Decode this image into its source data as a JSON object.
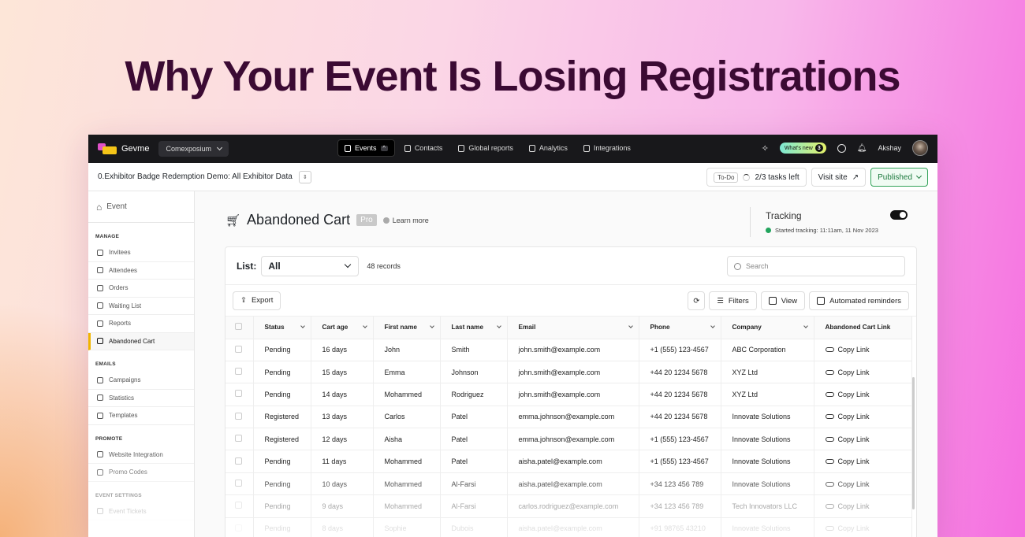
{
  "headline": "Why Your Event Is Losing Registrations",
  "topbar": {
    "brand": "Gevme",
    "org": "Comexposium",
    "nav": [
      {
        "label": "Events",
        "icon": "list-icon",
        "active": true,
        "chip": "^"
      },
      {
        "label": "Contacts",
        "icon": "contacts-icon"
      },
      {
        "label": "Global reports",
        "icon": "report-icon"
      },
      {
        "label": "Analytics",
        "icon": "pie-chart-icon"
      },
      {
        "label": "Integrations",
        "icon": "puzzle-icon"
      }
    ],
    "whats_new": "What's new",
    "whats_new_count": "3",
    "user": "Akshay"
  },
  "subbar": {
    "event_title": "0.Exhibitor Badge Redemption Demo: All Exhibitor Data",
    "todo": "To-Do",
    "tasks": "2/3 tasks left",
    "visit": "Visit site",
    "published": "Published"
  },
  "sidebar": {
    "event": "Event",
    "sections": [
      {
        "title": "MANAGE",
        "items": [
          {
            "label": "Invitees",
            "icon": "person-icon"
          },
          {
            "label": "Attendees",
            "icon": "person-icon"
          },
          {
            "label": "Orders",
            "icon": "table-icon"
          },
          {
            "label": "Waiting List",
            "icon": "list-icon"
          },
          {
            "label": "Reports",
            "icon": "grid-icon"
          },
          {
            "label": "Abandoned Cart",
            "icon": "cart-icon",
            "active": true
          }
        ]
      },
      {
        "title": "EMAILS",
        "items": [
          {
            "label": "Campaigns",
            "icon": "mail-icon"
          },
          {
            "label": "Statistics",
            "icon": "bar-chart-icon"
          },
          {
            "label": "Templates",
            "icon": "doc-icon"
          }
        ]
      },
      {
        "title": "PROMOTE",
        "items": [
          {
            "label": "Website Integration",
            "icon": "arrows-icon"
          },
          {
            "label": "Promo Codes",
            "icon": "star-icon"
          }
        ]
      },
      {
        "title": "EVENT SETTINGS",
        "items": [
          {
            "label": "Event Tickets",
            "icon": "ticket-icon"
          }
        ]
      }
    ]
  },
  "page": {
    "title": "Abandoned Cart",
    "badge": "Pro",
    "learn_more": "Learn more",
    "tracking": {
      "label": "Tracking",
      "status": "Started tracking: 11:11am, 11 Nov 2023",
      "enabled": true
    },
    "list_label": "List:",
    "list_value": "All",
    "records": "48 records",
    "search_placeholder": "Search",
    "export": "Export",
    "filters": "Filters",
    "view": "View",
    "reminders": "Automated reminders"
  },
  "table": {
    "columns": [
      "Status",
      "Cart age",
      "First name",
      "Last name",
      "Email",
      "Phone",
      "Company",
      "Abandoned Cart Link"
    ],
    "rows": [
      [
        "Pending",
        "16 days",
        "John",
        "Smith",
        "john.smith@example.com",
        "+1 (555) 123-4567",
        "ABC Corporation",
        "Copy Link"
      ],
      [
        "Pending",
        "15 days",
        "Emma",
        "Johnson",
        "john.smith@example.com",
        "+44 20 1234 5678",
        "XYZ Ltd",
        "Copy Link"
      ],
      [
        "Pending",
        "14 days",
        "Mohammed",
        "Rodriguez",
        "john.smith@example.com",
        "+44 20 1234 5678",
        "XYZ Ltd",
        "Copy Link"
      ],
      [
        "Registered",
        "13 days",
        "Carlos",
        "Patel",
        "emma.johnson@example.com",
        "+44 20 1234 5678",
        "Innovate Solutions",
        "Copy Link"
      ],
      [
        "Registered",
        "12 days",
        "Aisha",
        "Patel",
        "emma.johnson@example.com",
        "+1 (555) 123-4567",
        "Innovate Solutions",
        "Copy Link"
      ],
      [
        "Pending",
        "11 days",
        "Mohammed",
        "Patel",
        "aisha.patel@example.com",
        "+1 (555) 123-4567",
        "Innovate Solutions",
        "Copy Link"
      ],
      [
        "Pending",
        "10 days",
        "Mohammed",
        "Al-Farsi",
        "aisha.patel@example.com",
        "+34 123 456 789",
        "Innovate Solutions",
        "Copy Link"
      ],
      [
        "Pending",
        "9 days",
        "Mohammed",
        "Al-Farsi",
        "carlos.rodriguez@example.com",
        "+34 123 456 789",
        "Tech Innovators LLC",
        "Copy Link"
      ],
      [
        "Pending",
        "8 days",
        "Sophie",
        "Dubois",
        "aisha.patel@example.com",
        "+91 98765 43210",
        "Innovate Solutions",
        "Copy Link"
      ]
    ]
  },
  "colors": {
    "accent": "#f0b400",
    "published": "#1d7a3e",
    "headline": "#3b0a33"
  }
}
